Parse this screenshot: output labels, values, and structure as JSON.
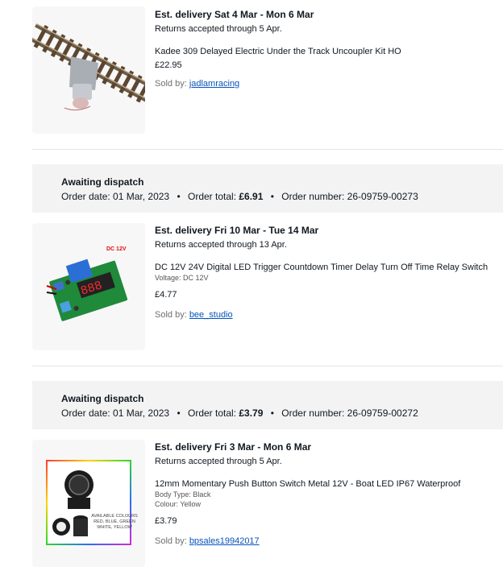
{
  "items": [
    {
      "delivery": "Est. delivery Sat 4 Mar - Mon 6 Mar",
      "returns": "Returns accepted through 5 Apr.",
      "title": "Kadee 309 Delayed Electric Under the Track Uncoupler Kit HO",
      "price": "£22.95",
      "sold_by_label": "Sold by:",
      "seller": "jadlamracing"
    },
    {
      "delivery": "Est. delivery Fri 10 Mar - Tue 14 Mar",
      "returns": "Returns accepted through 13 Apr.",
      "title": "DC 12V 24V Digital LED Trigger Countdown Timer Delay Turn Off Time Relay Switch",
      "attributes": [
        {
          "label": "Voltage:",
          "value": "DC 12V"
        }
      ],
      "price": "£4.77",
      "sold_by_label": "Sold by:",
      "seller": "bee_studio",
      "image_badge": "DC 12V",
      "image_display": "888"
    },
    {
      "delivery": "Est. delivery Fri 3 Mar - Mon 6 Mar",
      "returns": "Returns accepted through 5 Apr.",
      "title": "12mm Momentary Push Button Switch Metal 12V - Boat LED IP67 Waterproof",
      "attributes": [
        {
          "label": "Body Type:",
          "value": "Black"
        },
        {
          "label": "Colour:",
          "value": "Yellow"
        }
      ],
      "price": "£3.79",
      "sold_by_label": "Sold by:",
      "seller": "bpsales19942017",
      "image_caption": [
        "AVAILABLE COLOURS",
        "RED, BLUE, GREEN",
        "WHITE, YELLOW"
      ]
    }
  ],
  "orders": [
    {
      "status": "Awaiting dispatch",
      "date_label": "Order date:",
      "date": "01 Mar, 2023",
      "total_label": "Order total:",
      "total": "£6.91",
      "number_label": "Order number:",
      "number": "26-09759-00273"
    },
    {
      "status": "Awaiting dispatch",
      "date_label": "Order date:",
      "date": "01 Mar, 2023",
      "total_label": "Order total:",
      "total": "£3.79",
      "number_label": "Order number:",
      "number": "26-09759-00272"
    }
  ],
  "separator": "•",
  "colors": {
    "link": "#0654ba",
    "header_bg": "#f3f3f3",
    "thumb_bg": "#f7f7f7"
  }
}
